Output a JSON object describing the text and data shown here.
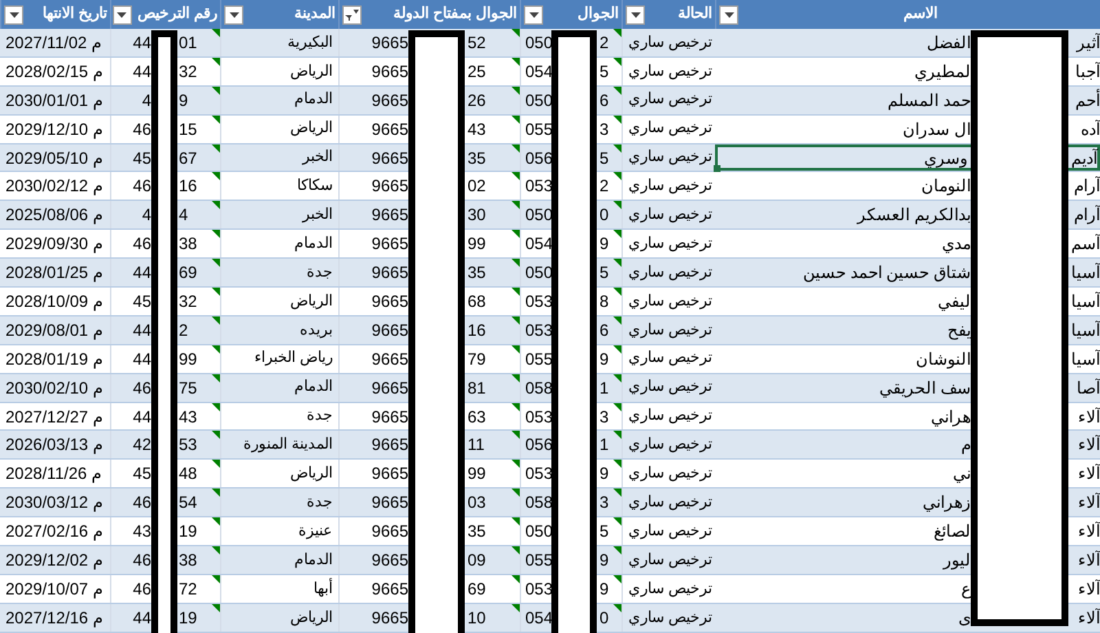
{
  "columns": [
    {
      "label": "الاسم",
      "kind": "dropdown"
    },
    {
      "label": "الحالة",
      "kind": "dropdown"
    },
    {
      "label": "الجوال",
      "kind": "dropdown"
    },
    {
      "label": "الجوال بمفتاح الدولة",
      "kind": "filter"
    },
    {
      "label": "المدينة",
      "kind": "dropdown"
    },
    {
      "label": "رقم الترخيص",
      "kind": "dropdown"
    },
    {
      "label": "تاريخ الانتها",
      "kind": "dropdown"
    }
  ],
  "rows": [
    {
      "name": [
        "آثير",
        "الفضل"
      ],
      "selected": false,
      "status": "ترخيص ساري",
      "mobile": [
        "2",
        "050"
      ],
      "intl": [
        "52",
        "9665"
      ],
      "city": "البكيرية",
      "license": [
        "01",
        "44"
      ],
      "date": "2027/11/02 م"
    },
    {
      "name": [
        "آجبا",
        "لمطيري"
      ],
      "selected": false,
      "status": "ترخيص ساري",
      "mobile": [
        "5",
        "054"
      ],
      "intl": [
        "25",
        "9665"
      ],
      "city": "الرياض",
      "license": [
        "32",
        "44"
      ],
      "date": "2028/02/15 م"
    },
    {
      "name": [
        "أحم",
        "حمد المسلم"
      ],
      "selected": false,
      "status": "ترخيص ساري",
      "mobile": [
        "6",
        "050"
      ],
      "intl": [
        "26",
        "9665"
      ],
      "city": "الدمام",
      "license": [
        "9",
        "4"
      ],
      "date": "2030/01/01 م"
    },
    {
      "name": [
        "آده",
        "ال سدران"
      ],
      "selected": false,
      "status": "ترخيص ساري",
      "mobile": [
        "3",
        "055"
      ],
      "intl": [
        "43",
        "9665"
      ],
      "city": "الرياض",
      "license": [
        "15",
        "46"
      ],
      "date": "2029/12/10 م"
    },
    {
      "name": [
        "آديم",
        "وسري"
      ],
      "selected": true,
      "status": "ترخيص ساري",
      "mobile": [
        "5",
        "056"
      ],
      "intl": [
        "35",
        "9665"
      ],
      "city": "الخبر",
      "license": [
        "67",
        "45"
      ],
      "date": "2029/05/10 م"
    },
    {
      "name": [
        "آرام",
        "النومان"
      ],
      "selected": false,
      "status": "ترخيص ساري",
      "mobile": [
        "2",
        "053"
      ],
      "intl": [
        "02",
        "9665"
      ],
      "city": "سكاكا",
      "license": [
        "16",
        "46"
      ],
      "date": "2030/02/12 م"
    },
    {
      "name": [
        "آرام",
        "بدالكريم العسكر"
      ],
      "selected": false,
      "status": "ترخيص ساري",
      "mobile": [
        "0",
        "050"
      ],
      "intl": [
        "30",
        "9665"
      ],
      "city": "الخبر",
      "license": [
        "4",
        "4"
      ],
      "date": "2025/08/06 م"
    },
    {
      "name": [
        "آسم",
        "مدي"
      ],
      "selected": false,
      "status": "ترخيص ساري",
      "mobile": [
        "9",
        "054"
      ],
      "intl": [
        "99",
        "9665"
      ],
      "city": "الدمام",
      "license": [
        "38",
        "46"
      ],
      "date": "2029/09/30 م"
    },
    {
      "name": [
        "آسيا",
        "شتاق حسين احمد حسين"
      ],
      "selected": false,
      "status": "ترخيص ساري",
      "mobile": [
        "5",
        "050"
      ],
      "intl": [
        "35",
        "9665"
      ],
      "city": "جدة",
      "license": [
        "69",
        "44"
      ],
      "date": "2028/01/25 م"
    },
    {
      "name": [
        "آسيا",
        "ليفي"
      ],
      "selected": false,
      "status": "ترخيص ساري",
      "mobile": [
        "8",
        "053"
      ],
      "intl": [
        "68",
        "9665"
      ],
      "city": "الرياض",
      "license": [
        "32",
        "45"
      ],
      "date": "2028/10/09 م"
    },
    {
      "name": [
        "آسيا",
        "يفح"
      ],
      "selected": false,
      "status": "ترخيص ساري",
      "mobile": [
        "6",
        "053"
      ],
      "intl": [
        "16",
        "9665"
      ],
      "city": "بريده",
      "license": [
        "2",
        "44"
      ],
      "date": "2029/08/01 م"
    },
    {
      "name": [
        "آسيا",
        "النوشان"
      ],
      "selected": false,
      "status": "ترخيص ساري",
      "mobile": [
        "9",
        "055"
      ],
      "intl": [
        "79",
        "9665"
      ],
      "city": "رياض الخبراء",
      "license": [
        "99",
        "44"
      ],
      "date": "2028/01/19 م"
    },
    {
      "name": [
        "آصا",
        "سف الحريقي"
      ],
      "selected": false,
      "status": "ترخيص ساري",
      "mobile": [
        "1",
        "058"
      ],
      "intl": [
        "81",
        "9665"
      ],
      "city": "الدمام",
      "license": [
        "75",
        "46"
      ],
      "date": "2030/02/10 م"
    },
    {
      "name": [
        "آلاء",
        "هراني"
      ],
      "selected": false,
      "status": "ترخيص ساري",
      "mobile": [
        "3",
        "053"
      ],
      "intl": [
        "63",
        "9665"
      ],
      "city": "جدة",
      "license": [
        "43",
        "44"
      ],
      "date": "2027/12/27 م"
    },
    {
      "name": [
        "آلاء",
        "م"
      ],
      "selected": false,
      "status": "ترخيص ساري",
      "mobile": [
        "1",
        "056"
      ],
      "intl": [
        "11",
        "9665"
      ],
      "city": "المدينة المنورة",
      "license": [
        "53",
        "42"
      ],
      "date": "2026/03/13 م"
    },
    {
      "name": [
        "آلاء",
        "ني"
      ],
      "selected": false,
      "status": "ترخيص ساري",
      "mobile": [
        "9",
        "053"
      ],
      "intl": [
        "99",
        "9665"
      ],
      "city": "الرياض",
      "license": [
        "48",
        "45"
      ],
      "date": "2028/11/26 م"
    },
    {
      "name": [
        "آلاء",
        "زهراني"
      ],
      "selected": false,
      "status": "ترخيص ساري",
      "mobile": [
        "3",
        "058"
      ],
      "intl": [
        "03",
        "9665"
      ],
      "city": "جدة",
      "license": [
        "54",
        "46"
      ],
      "date": "2030/03/12 م"
    },
    {
      "name": [
        "آلاء",
        "لصائغ"
      ],
      "selected": false,
      "status": "ترخيص ساري",
      "mobile": [
        "5",
        "050"
      ],
      "intl": [
        "35",
        "9665"
      ],
      "city": "عنيزة",
      "license": [
        "19",
        "43"
      ],
      "date": "2027/02/16 م"
    },
    {
      "name": [
        "آلاء",
        "ليور"
      ],
      "selected": false,
      "status": "ترخيص ساري",
      "mobile": [
        "9",
        "055"
      ],
      "intl": [
        "09",
        "9665"
      ],
      "city": "الدمام",
      "license": [
        "38",
        "46"
      ],
      "date": "2029/12/02 م"
    },
    {
      "name": [
        "آلاء",
        "ع"
      ],
      "selected": false,
      "status": "ترخيص ساري",
      "mobile": [
        "9",
        "053"
      ],
      "intl": [
        "69",
        "9665"
      ],
      "city": "أبها",
      "license": [
        "72",
        "46"
      ],
      "date": "2029/10/07 م"
    },
    {
      "name": [
        "آلاء",
        "ى"
      ],
      "selected": false,
      "status": "ترخيص ساري",
      "mobile": [
        "0",
        "054"
      ],
      "intl": [
        "10",
        "9665"
      ],
      "city": "الرياض",
      "license": [
        "19",
        "44"
      ],
      "date": "2027/12/16 م"
    }
  ]
}
